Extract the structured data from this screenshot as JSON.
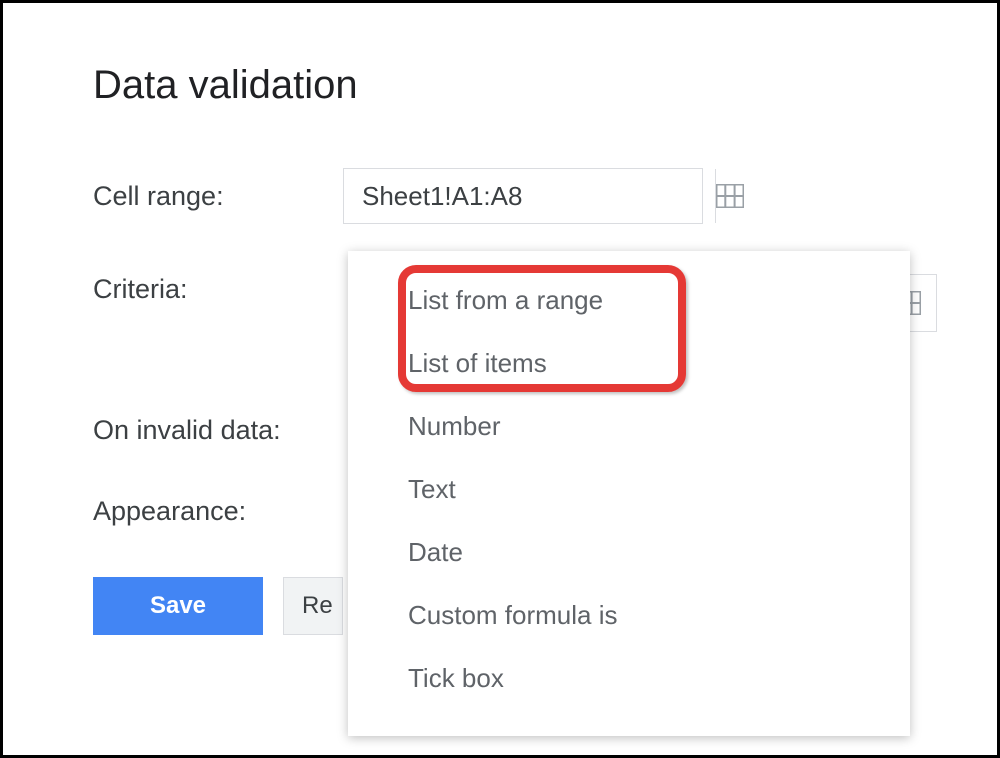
{
  "dialog": {
    "title": "Data validation"
  },
  "cell_range": {
    "label": "Cell range:",
    "value": "Sheet1!A1:A8"
  },
  "criteria": {
    "label": "Criteria:",
    "options": [
      "List from a range",
      "List of items",
      "Number",
      "Text",
      "Date",
      "Custom formula is",
      "Tick box"
    ]
  },
  "invalid_data": {
    "label": "On invalid data:"
  },
  "appearance": {
    "label": "Appearance:"
  },
  "buttons": {
    "save": "Save",
    "cancel_partial": "Re"
  }
}
